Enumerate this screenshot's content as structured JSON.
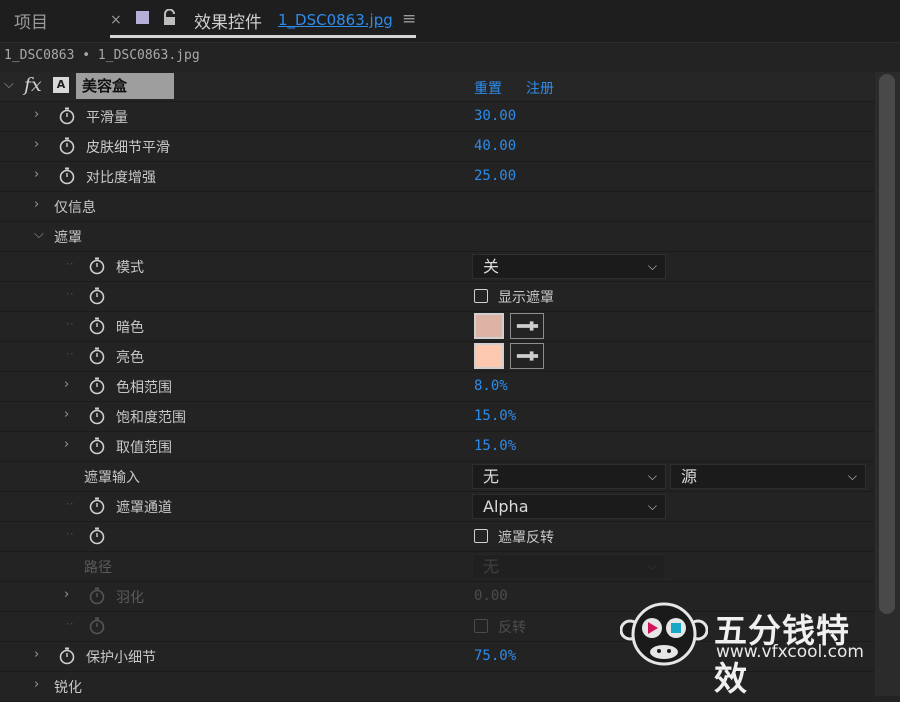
{
  "tabs": {
    "project": "项目",
    "close": "×",
    "effect_controls": "效果控件",
    "file": "1_DSC0863.jpg",
    "menu": "≡"
  },
  "breadcrumb": "1_DSC0863 • 1_DSC0863.jpg",
  "effect": {
    "fx": "fx",
    "badge": "A",
    "name": "美容盒",
    "reset": "重置",
    "register": "注册"
  },
  "rows": {
    "smoothness": {
      "label": "平滑量",
      "value": "30.00"
    },
    "skin_detail": {
      "label": "皮肤细节平滑",
      "value": "40.00"
    },
    "contrast": {
      "label": "对比度增强",
      "value": "25.00"
    },
    "info_only": {
      "label": "仅信息"
    },
    "mask": {
      "label": "遮罩"
    },
    "mode": {
      "label": "模式",
      "value": "关"
    },
    "show_mask": {
      "label": "显示遮罩"
    },
    "dark_color": {
      "label": "暗色",
      "color": "#dcb3a4"
    },
    "light_color": {
      "label": "亮色",
      "color": "#fcc9b0"
    },
    "hue_range": {
      "label": "色相范围",
      "value": "8.0%"
    },
    "saturation_range": {
      "label": "饱和度范围",
      "value": "15.0%"
    },
    "value_range": {
      "label": "取值范围",
      "value": "15.0%"
    },
    "mask_input": {
      "label": "遮罩输入",
      "value": "无",
      "source": "源"
    },
    "mask_channel": {
      "label": "遮罩通道",
      "value": "Alpha"
    },
    "mask_invert": {
      "label": "遮罩反转"
    },
    "path": {
      "label": "路径",
      "value": "无"
    },
    "feather": {
      "label": "羽化",
      "value": "0.00"
    },
    "invert": {
      "label": "反转"
    },
    "protect_detail": {
      "label": "保护小细节",
      "value": "75.0%"
    },
    "sharpen": {
      "label": "锐化"
    }
  },
  "watermark": {
    "title": "五分钱特效",
    "url": "www.vfxcool.com"
  },
  "colors": {
    "accent": "#2d8ceb",
    "background": "#232323"
  }
}
